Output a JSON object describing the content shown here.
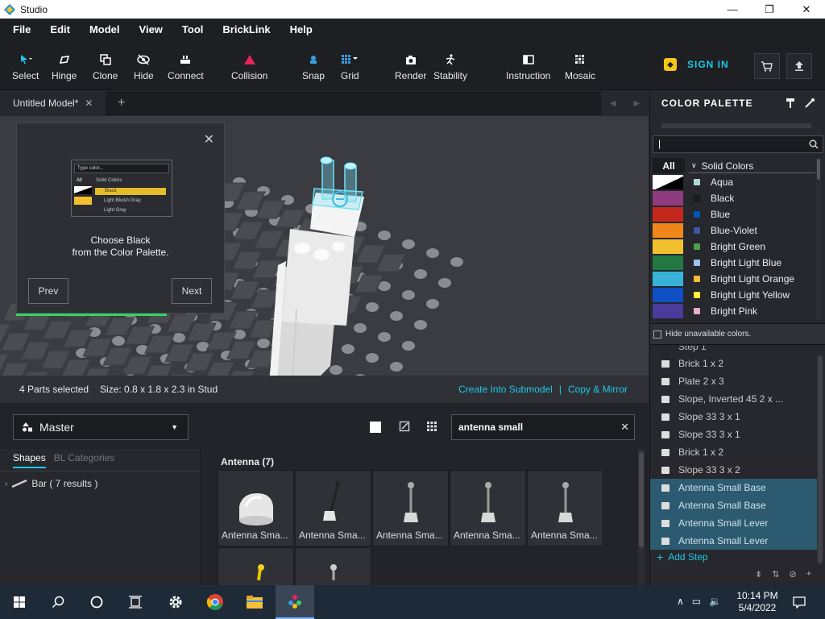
{
  "window": {
    "title": "Studio",
    "min": "—",
    "max": "❐",
    "close": "✕"
  },
  "menu": [
    "File",
    "Edit",
    "Model",
    "View",
    "Tool",
    "BrickLink",
    "Help"
  ],
  "toolbar": {
    "select": "Select",
    "hinge": "Hinge",
    "clone": "Clone",
    "hide": "Hide",
    "connect": "Connect",
    "collision": "Collision",
    "snap": "Snap",
    "grid": "Grid",
    "render": "Render",
    "stability": "Stability",
    "instruction": "Instruction",
    "mosaic": "Mosaic",
    "sign_in": "SIGN IN"
  },
  "tabs": {
    "active": "Untitled Model*",
    "close": "✕",
    "add": "+"
  },
  "tutorial": {
    "message_line1": "Choose Black",
    "message_line2": "from the Color Palette.",
    "prev": "Prev",
    "next": "Next",
    "thumb": {
      "search": "Type color...",
      "all": "All",
      "group": "Solid Colors",
      "items": [
        "Black",
        "Light Bluish Gray",
        "Light Gray"
      ]
    }
  },
  "status": {
    "parts_selected": "4 Parts selected",
    "size": "Size: 0.8 x 1.8 x 2.3 in Stud",
    "create_submodel": "Create Into Submodel",
    "separator": "|",
    "copy_mirror": "Copy & Mirror"
  },
  "master": {
    "label": "Master"
  },
  "part_search": {
    "value": "antenna small"
  },
  "categories": {
    "tab_shapes": "Shapes",
    "tab_bl": "BL Categories",
    "items": [
      {
        "label": "Bar ( 7 results )"
      }
    ]
  },
  "parts": {
    "header": "Antenna (7)",
    "items": [
      {
        "label": "Antenna Sma..."
      },
      {
        "label": "Antenna Sma..."
      },
      {
        "label": "Antenna Sma..."
      },
      {
        "label": "Antenna Sma..."
      },
      {
        "label": "Antenna Sma..."
      },
      {
        "label": ""
      },
      {
        "label": ""
      }
    ]
  },
  "color_palette": {
    "title": "COLOR PALETTE",
    "all": "All",
    "group": "Solid Colors",
    "swatches": [
      "#ffffff",
      "#8e3a7f",
      "#c4281c",
      "#f0861a",
      "#f2c02e",
      "#237841",
      "#38b2d8",
      "#0f4fc4",
      "#4a3a9a"
    ],
    "colors": [
      {
        "name": "Aqua",
        "hex": "#b3d7d1"
      },
      {
        "name": "Black",
        "hex": "#1b1b1b"
      },
      {
        "name": "Blue",
        "hex": "#0055bf"
      },
      {
        "name": "Blue-Violet",
        "hex": "#4354a3"
      },
      {
        "name": "Bright Green",
        "hex": "#4b9f4a"
      },
      {
        "name": "Bright Light Blue",
        "hex": "#9fc3e9"
      },
      {
        "name": "Bright Light Orange",
        "hex": "#f8bb3d"
      },
      {
        "name": "Bright Light Yellow",
        "hex": "#fff03a"
      },
      {
        "name": "Bright Pink",
        "hex": "#e4adc8"
      }
    ],
    "hide_unavailable": "Hide unavailable colors."
  },
  "steps": {
    "partial_header": "Step 1",
    "items": [
      {
        "label": "Brick 1 x 2",
        "selected": false
      },
      {
        "label": "Plate 2 x 3",
        "selected": false
      },
      {
        "label": "Slope, Inverted 45 2 x ...",
        "selected": false
      },
      {
        "label": "Slope 33 3 x 1",
        "selected": false
      },
      {
        "label": "Slope 33 3 x 1",
        "selected": false
      },
      {
        "label": "Brick 1 x 2",
        "selected": false
      },
      {
        "label": "Slope 33 3 x 2",
        "selected": false
      },
      {
        "label": "Antenna Small Base",
        "selected": true
      },
      {
        "label": "Antenna Small Base",
        "selected": true
      },
      {
        "label": "Antenna Small Lever",
        "selected": true
      },
      {
        "label": "Antenna Small Lever",
        "selected": true
      }
    ],
    "add_step": "Add Step"
  },
  "taskbar": {
    "time": "10:14 PM",
    "date": "5/4/2022"
  },
  "colors": {
    "accent": "#1ec8e6",
    "selection": "#2c5a70",
    "brand_yellow": "#f5c518",
    "collision": "#e8245a"
  }
}
